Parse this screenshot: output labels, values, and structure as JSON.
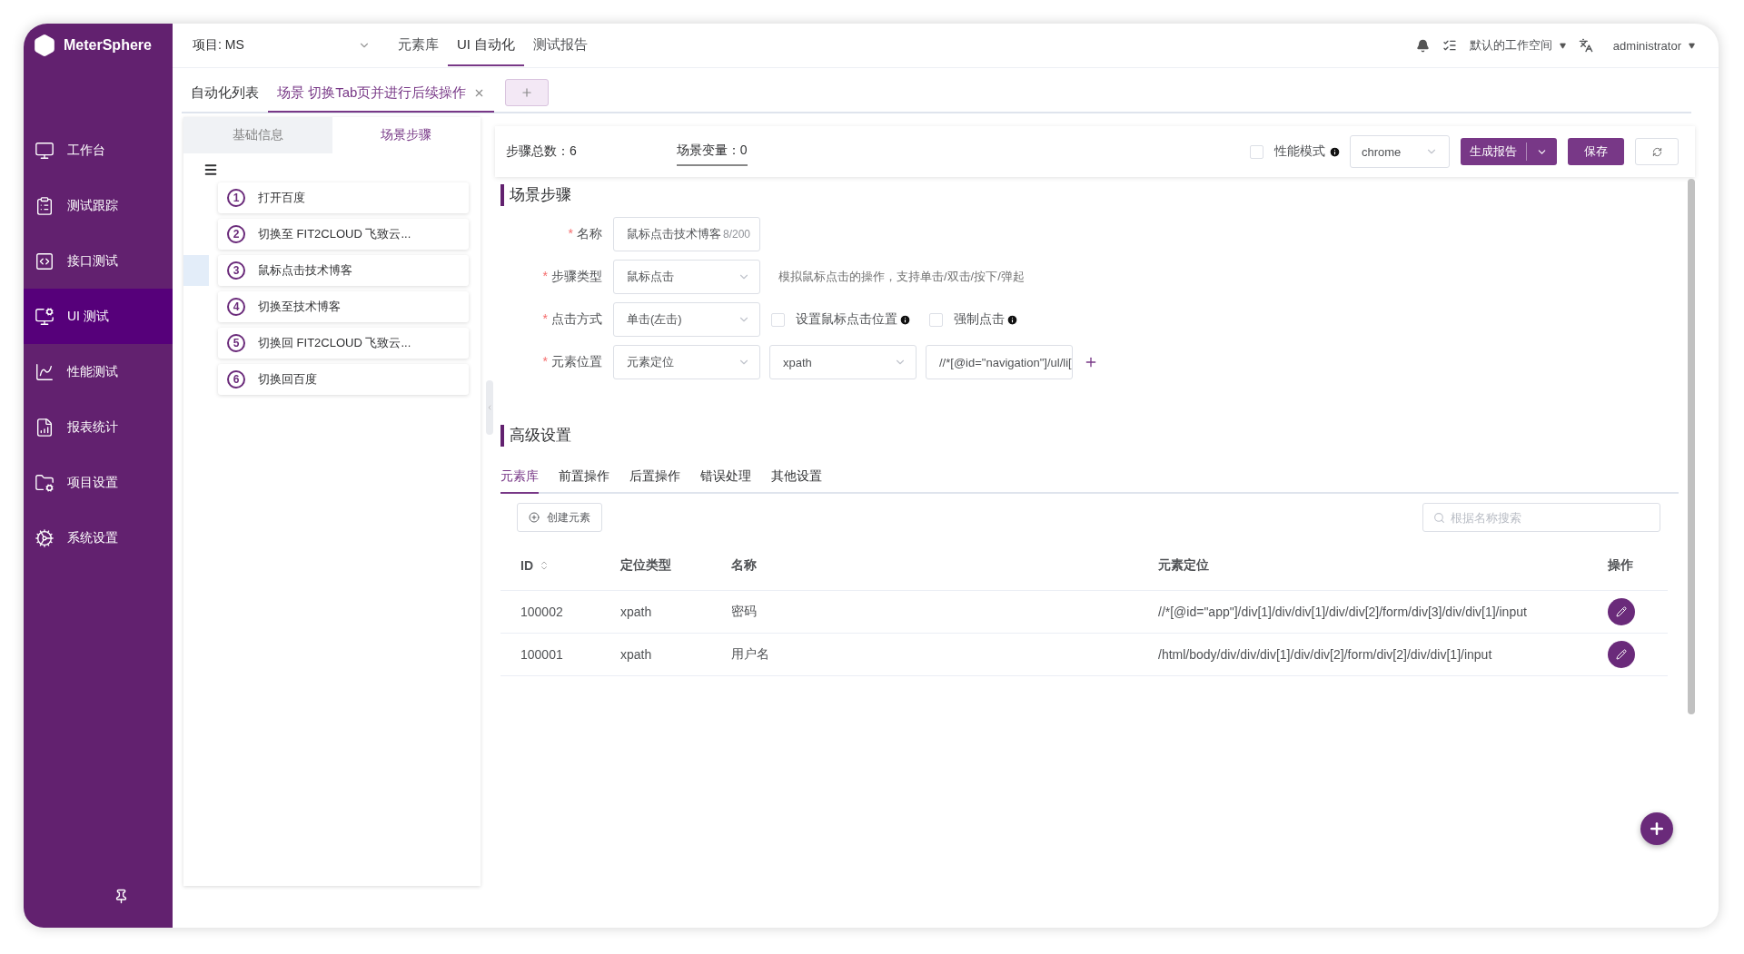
{
  "sidebar": {
    "logo": "MeterSphere",
    "items": [
      {
        "label": "工作台",
        "selected": false
      },
      {
        "label": "测试跟踪",
        "selected": false
      },
      {
        "label": "接口测试",
        "selected": false
      },
      {
        "label": "UI 测试",
        "selected": true
      },
      {
        "label": "性能测试",
        "selected": false
      },
      {
        "label": "报表统计",
        "selected": false
      },
      {
        "label": "项目设置",
        "selected": false
      },
      {
        "label": "系统设置",
        "selected": false
      }
    ]
  },
  "header": {
    "project": "项目: MS",
    "nav": [
      {
        "label": "元素库",
        "selected": false
      },
      {
        "label": "UI 自动化",
        "selected": true
      },
      {
        "label": "测试报告",
        "selected": false
      }
    ],
    "workspace": "默认的工作空间",
    "user": "administrator"
  },
  "tabs": [
    {
      "label": "自动化列表",
      "selected": false,
      "closable": false
    },
    {
      "label": "场景 切换Tab页并进行后续操作",
      "selected": true,
      "closable": true
    }
  ],
  "step_panel": {
    "tabs": [
      {
        "label": "基础信息",
        "selected": false
      },
      {
        "label": "场景步骤",
        "selected": true
      }
    ],
    "steps": [
      {
        "number": "1",
        "label": "打开百度",
        "selected": false
      },
      {
        "number": "2",
        "label": "切换至 FIT2CLOUD 飞致云...",
        "selected": false
      },
      {
        "number": "3",
        "label": "鼠标点击技术博客",
        "selected": true
      },
      {
        "number": "4",
        "label": "切换至技术博客",
        "selected": false
      },
      {
        "number": "5",
        "label": "切换回 FIT2CLOUD 飞致云...",
        "selected": false
      },
      {
        "number": "6",
        "label": "切换回百度",
        "selected": false
      }
    ]
  },
  "toolbar": {
    "step_count": "步骤总数：6",
    "variables": "场景变量：0",
    "performance_mode": {
      "label": "性能模式",
      "checked": false
    },
    "browser": "chrome",
    "report_button": "生成报告",
    "save_button": "保存"
  },
  "step_form": {
    "title": "场景步骤",
    "fields": [
      {
        "kind": "text",
        "required_mark": "*",
        "label": "名称",
        "value": "鼠标点击技术博客",
        "counter": "8/200"
      },
      {
        "kind": "select",
        "required_mark": "*",
        "label": "步骤类型",
        "value": "鼠标点击",
        "hint": "模拟鼠标点击的操作，支持单击/双击/按下/弹起"
      },
      {
        "kind": "select",
        "required_mark": "*",
        "label": "点击方式",
        "value": "单击(左击)",
        "options": [
          {
            "label": "设置鼠标点击位置",
            "checked": false
          },
          {
            "label": "强制点击",
            "checked": false
          }
        ]
      },
      {
        "kind": "locator",
        "required_mark": "*",
        "label": "元素位置",
        "value": "元素定位",
        "locator_type": "xpath",
        "locator": "//*[@id=\"navigation\"]/ul/li["
      }
    ]
  },
  "advanced": {
    "title": "高级设置",
    "tabs": [
      {
        "label": "元素库",
        "selected": true
      },
      {
        "label": "前置操作",
        "selected": false
      },
      {
        "label": "后置操作",
        "selected": false
      },
      {
        "label": "错误处理",
        "selected": false
      },
      {
        "label": "其他设置",
        "selected": false
      }
    ],
    "create_button": "创建元素",
    "search": {
      "placeholder": "根据名称搜索"
    },
    "table": {
      "columns": [
        "ID",
        "定位类型",
        "名称",
        "元素定位",
        "操作"
      ],
      "rows": [
        {
          "id": "100002",
          "type": "xpath",
          "name": "密码",
          "locator": "//*[@id=\"app\"]/div[1]/div/div[1]/div/div[2]/form/div[3]/div/div[1]/input"
        },
        {
          "id": "100001",
          "type": "xpath",
          "name": "用户名",
          "locator": "/html/body/div/div/div[1]/div/div[2]/form/div[2]/div/div[1]/input"
        }
      ]
    }
  }
}
